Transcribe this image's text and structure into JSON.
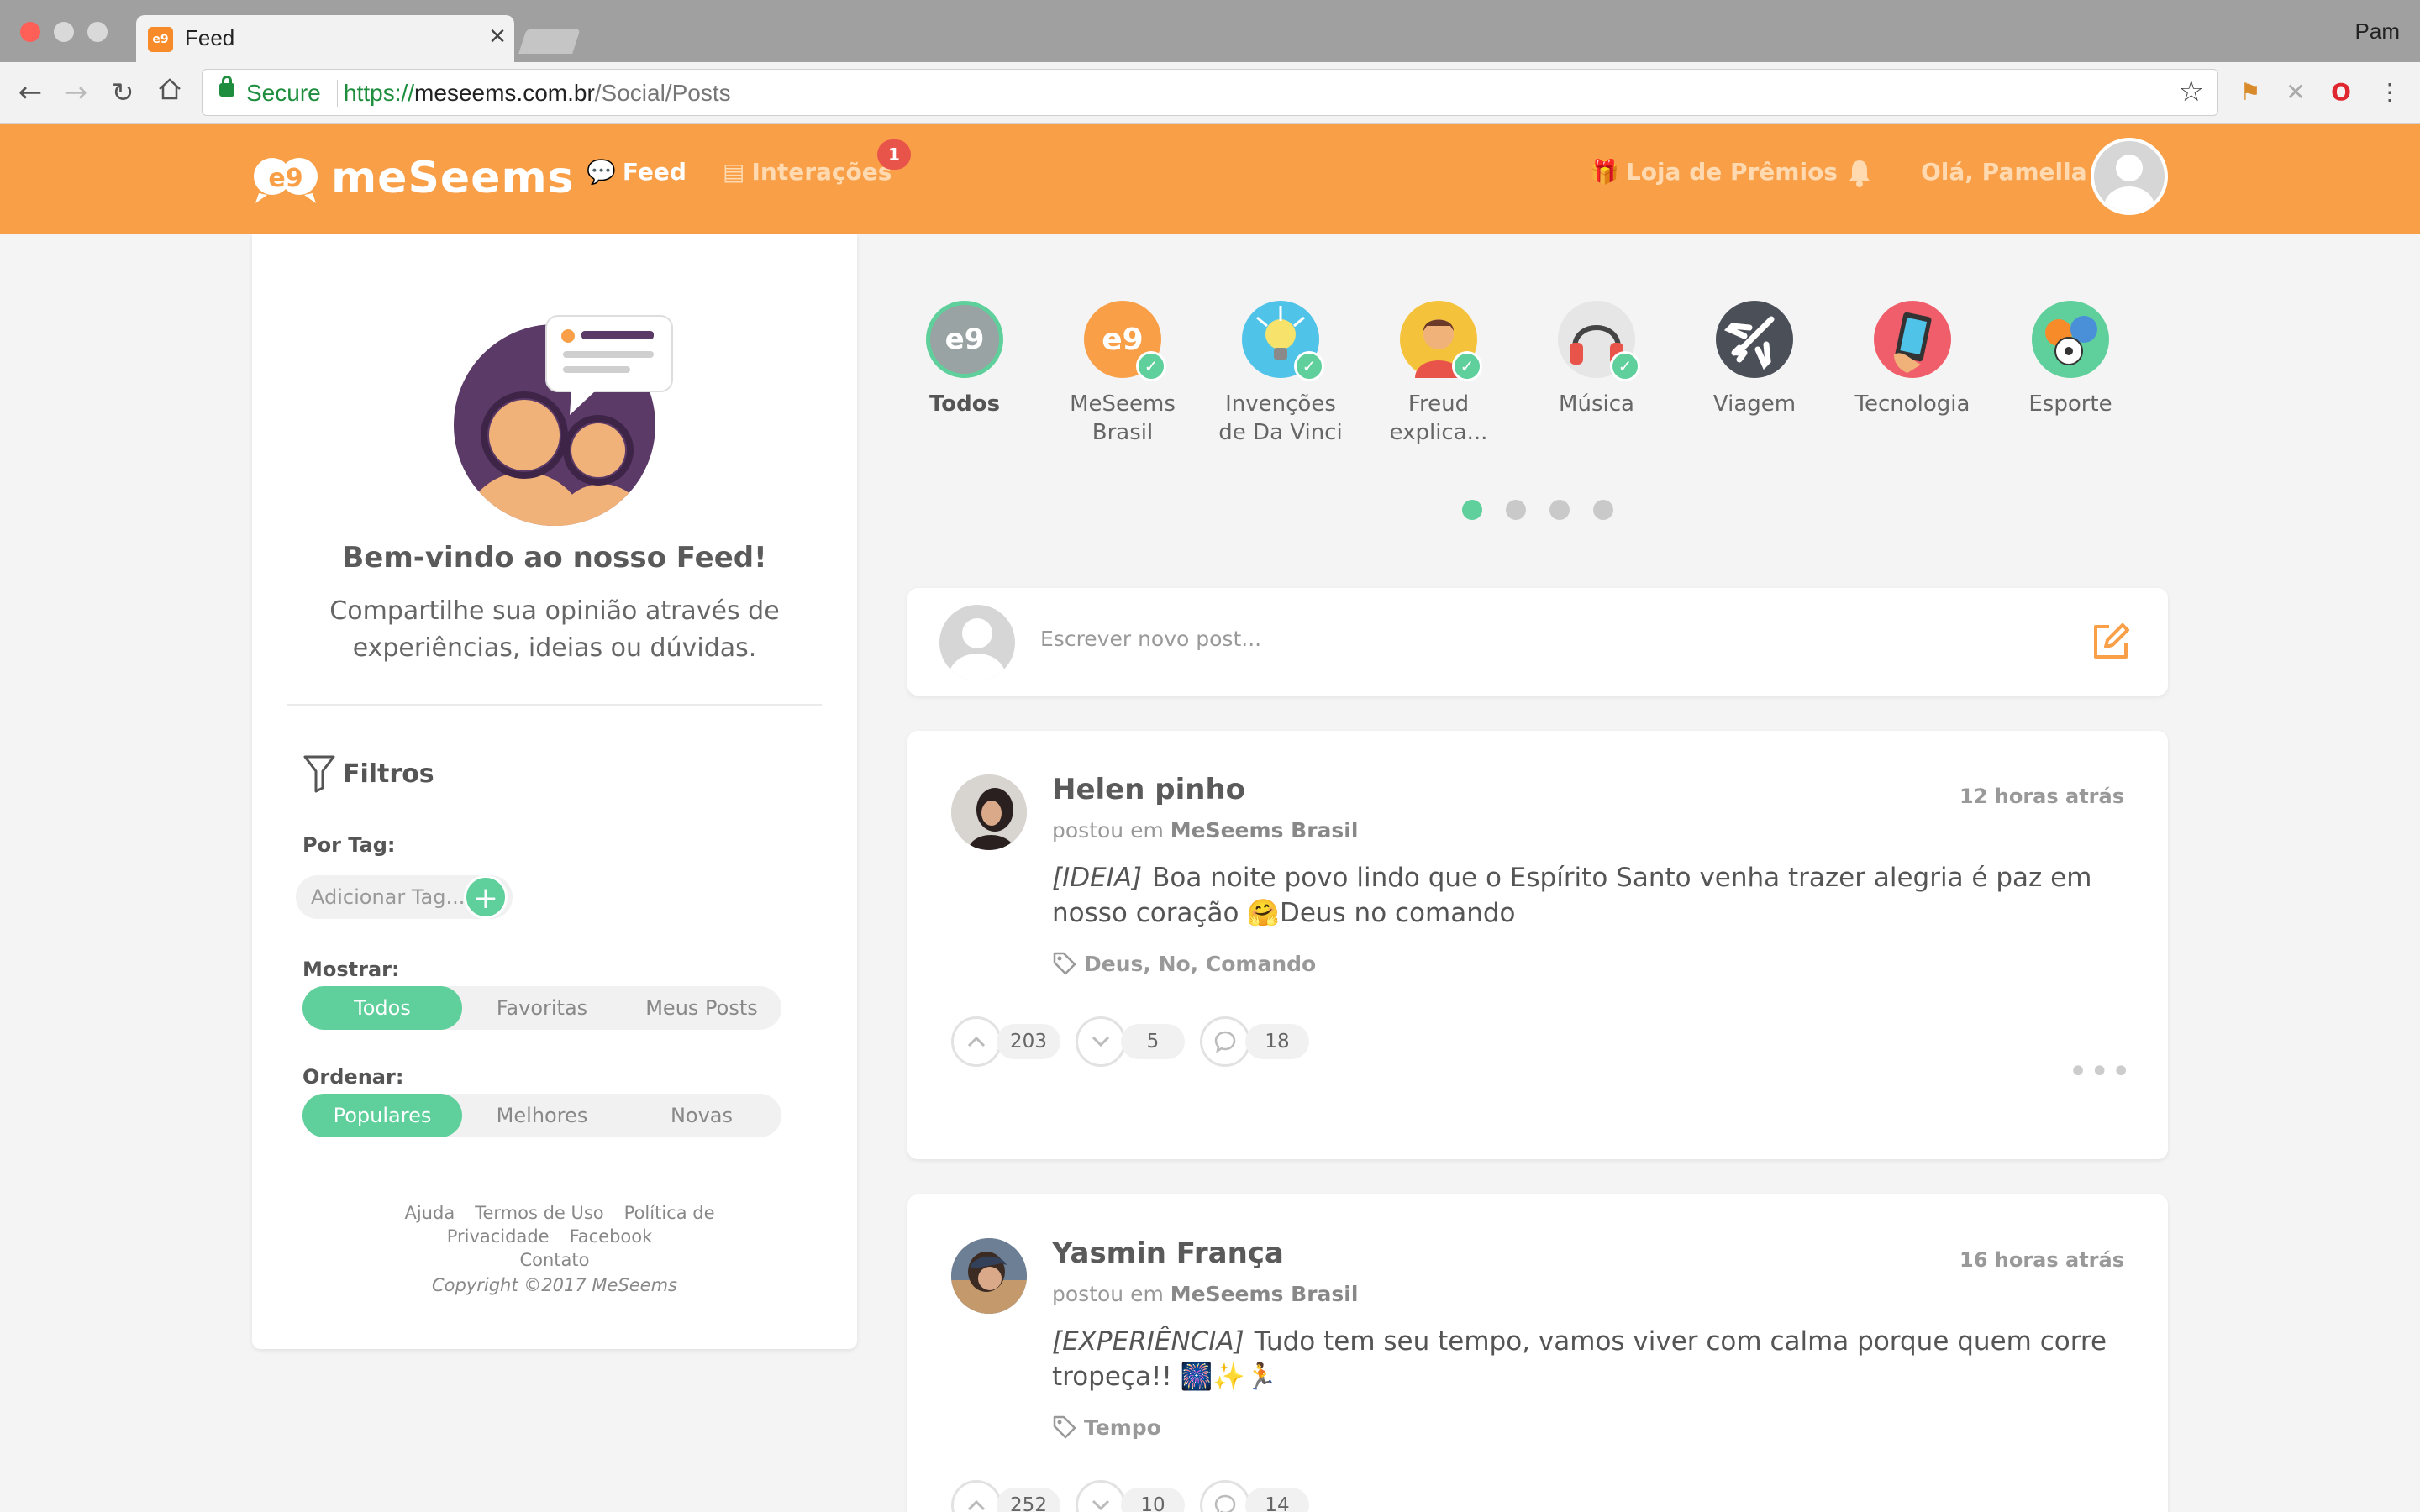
{
  "browser": {
    "tab_title": "Feed",
    "profile_name": "Pam",
    "secure_label": "Secure",
    "url_scheme": "https://",
    "url_host": "meseems.com.br",
    "url_path": "/Social/Posts"
  },
  "header": {
    "logo_text": "meSeems",
    "nav_feed": "Feed",
    "nav_interactions": "Interações",
    "interactions_badge": "1",
    "nav_store": "Loja de Prêmios",
    "greeting": "Olá, Pamella",
    "accent_color": "#f99f48"
  },
  "sidebar": {
    "welcome_title": "Bem-vindo ao nosso Feed!",
    "welcome_text": "Compartilhe sua opinião através de experiências, ideias ou dúvidas.",
    "filters_title": "Filtros",
    "by_tag_label": "Por Tag:",
    "tag_placeholder": "Adicionar Tag...",
    "show_label": "Mostrar:",
    "show_options": [
      "Todos",
      "Favoritas",
      "Meus Posts"
    ],
    "show_selected": "Todos",
    "order_label": "Ordenar:",
    "order_options": [
      "Populares",
      "Melhores",
      "Novas"
    ],
    "order_selected": "Populares",
    "footer_links": [
      "Ajuda",
      "Termos de Uso",
      "Política de Privacidade",
      "Facebook",
      "Contato"
    ],
    "copyright": "Copyright ©2017 MeSeems"
  },
  "categories": [
    {
      "label": "Todos",
      "icon": "meseems-logo-icon",
      "color": "#9aa3a3",
      "verified": false,
      "active": true
    },
    {
      "label": "MeSeems Brasil",
      "icon": "meseems-logo-icon",
      "color": "#f99f48",
      "verified": true
    },
    {
      "label": "Invenções de Da Vinci",
      "icon": "lightbulb-icon",
      "color": "#4fc3e8",
      "verified": true
    },
    {
      "label": "Freud explica...",
      "icon": "person-icon",
      "color": "#f5c33b",
      "verified": true
    },
    {
      "label": "Música",
      "icon": "headphones-icon",
      "color": "#e6e6e6",
      "verified": true
    },
    {
      "label": "Viagem",
      "icon": "airplane-icon",
      "color": "#4a4f58",
      "verified": false
    },
    {
      "label": "Tecnologia",
      "icon": "tablet-icon",
      "color": "#ef5e6a",
      "verified": false
    },
    {
      "label": "Esporte",
      "icon": "sports-balls-icon",
      "color": "#5fcf9c",
      "verified": false
    }
  ],
  "carousel": {
    "pages": 4,
    "current": 1
  },
  "composer": {
    "placeholder": "Escrever novo post..."
  },
  "posts": [
    {
      "author": "Helen pinho",
      "time": "12 horas atrás",
      "posted_in_prefix": "postou em",
      "community": "MeSeems Brasil",
      "kind": "[IDEIA]",
      "text": "Boa noite povo lindo que o Espírito Santo venha trazer alegria é paz em nosso coração 🤗Deus no comando",
      "tags": "Deus, No, Comando",
      "upvotes": "203",
      "downvotes": "5",
      "comments": "18"
    },
    {
      "author": "Yasmin França",
      "time": "16 horas atrás",
      "posted_in_prefix": "postou em",
      "community": "MeSeems Brasil",
      "kind": "[EXPERIÊNCIA]",
      "text": "Tudo tem seu tempo, vamos viver com calma porque quem corre tropeça!! 🎆✨🏃",
      "tags": "Tempo",
      "upvotes": "252",
      "downvotes": "10",
      "comments": "14"
    }
  ]
}
